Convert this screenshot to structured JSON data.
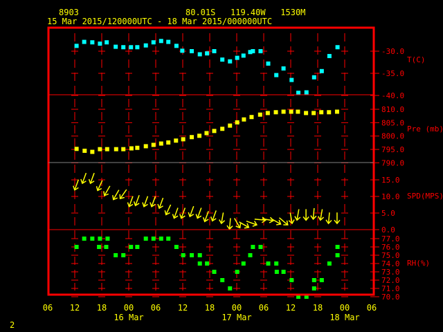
{
  "header": {
    "station": "8903",
    "location": "80.01S   119.40W   1530M",
    "period": "15 Mar 2015/120000UTC - 18 Mar 2015/000000UTC"
  },
  "page_number": "2",
  "x_axis": {
    "time_unit": "hours since 15 Mar 2015 12 UTC",
    "hour_labels": [
      "06",
      "12",
      "18",
      "00",
      "06",
      "12",
      "18",
      "00",
      "06",
      "12",
      "18",
      "00",
      "06"
    ],
    "hour_label_values": [
      -6,
      0,
      6,
      12,
      18,
      24,
      30,
      36,
      42,
      48,
      54,
      60,
      66
    ],
    "date_labels": [
      {
        "text": "16 Mar",
        "t": 12
      },
      {
        "text": "17 Mar",
        "t": 36
      },
      {
        "text": "18 Mar",
        "t": 60
      }
    ]
  },
  "colors": {
    "frame": "#ff0000",
    "temperature": "#00ffff",
    "pressure": "#ffff00",
    "wind": "#ffff00",
    "rh": "#00ff00",
    "text": "#ffff00",
    "grid_gray": "#808080"
  },
  "chart_data": [
    {
      "type": "scatter",
      "panel": "temperature",
      "ylabel": "T(C)",
      "ylim": [
        -40,
        -25
      ],
      "ticks": [
        "-30.0",
        "-35.0",
        "-40.0"
      ],
      "tick_values": [
        -30,
        -35,
        -40
      ],
      "x": [
        0.4,
        2.1,
        3.9,
        5.6,
        7.1,
        9.1,
        10.8,
        12.5,
        13.9,
        15.8,
        17.5,
        19.2,
        20.8,
        22.6,
        23.9,
        26.0,
        27.8,
        29.4,
        31.0,
        32.8,
        34.5,
        36.1,
        37.5,
        39.0,
        39.6,
        41.3,
        43.0,
        44.8,
        46.4,
        48.2,
        49.7,
        51.5,
        53.2,
        54.9,
        56.6,
        58.4
      ],
      "y": [
        -28.8,
        -27.9,
        -28.0,
        -28.3,
        -28.0,
        -29.0,
        -29.1,
        -29.1,
        -29.1,
        -28.7,
        -28.0,
        -27.7,
        -27.9,
        -28.8,
        -29.9,
        -30.0,
        -30.7,
        -30.5,
        -30.0,
        -31.9,
        -32.3,
        -31.5,
        -31.0,
        -30.2,
        -30.0,
        -30.0,
        -32.8,
        -35.4,
        -33.9,
        -36.5,
        -39.4,
        -39.3,
        -35.9,
        -34.5,
        -31.1,
        -29.1
      ]
    },
    {
      "type": "scatter",
      "panel": "pressure",
      "ylabel": "Pre (mb)",
      "ylim": [
        790,
        812
      ],
      "ticks": [
        "810.0",
        "805.0",
        "800.0",
        "795.0",
        "790.0"
      ],
      "tick_values": [
        810,
        805,
        800,
        795,
        790
      ],
      "x": [
        0.4,
        2.2,
        3.9,
        5.6,
        7.2,
        9.2,
        10.8,
        12.6,
        13.9,
        15.8,
        17.5,
        19.2,
        20.8,
        22.5,
        24.1,
        26.0,
        27.7,
        29.3,
        31.0,
        32.8,
        34.5,
        36.1,
        37.6,
        39.3,
        41.2,
        42.9,
        44.7,
        46.4,
        48.1,
        49.6,
        51.4,
        53.1,
        54.8,
        56.5,
        58.3
      ],
      "y": [
        795.2,
        794.5,
        794.1,
        795.1,
        795.1,
        795.1,
        795.1,
        795.4,
        795.6,
        796.2,
        796.7,
        797.2,
        797.6,
        798.3,
        798.8,
        799.6,
        800.1,
        801.1,
        801.9,
        802.7,
        803.9,
        805.1,
        806.2,
        807.1,
        808.0,
        808.6,
        808.9,
        809.1,
        809.1,
        809.1,
        808.6,
        808.6,
        808.9,
        808.9,
        809.1
      ]
    },
    {
      "type": "scatter",
      "panel": "wind",
      "ylabel": "SPD(MPS)",
      "ylim": [
        0,
        20
      ],
      "ticks": [
        "15.0",
        "10.0",
        "5.0",
        "0.0"
      ],
      "tick_values": [
        15,
        10,
        5,
        0
      ],
      "x": [
        0.4,
        2.1,
        3.9,
        5.6,
        7.2,
        9.2,
        10.8,
        12.5,
        13.9,
        15.8,
        17.5,
        19.2,
        20.8,
        22.5,
        24.1,
        26.0,
        27.7,
        29.3,
        31.0,
        32.8,
        34.5,
        36.1,
        37.6,
        39.3,
        41.2,
        42.9,
        44.7,
        46.4,
        48.1,
        49.6,
        51.4,
        53.1,
        54.8,
        56.5,
        58.3
      ],
      "y": [
        13.5,
        15.5,
        15.5,
        13.3,
        11.7,
        10.5,
        10.7,
        8.5,
        8.8,
        8.5,
        8.5,
        8.0,
        6.0,
        5.0,
        5.0,
        5.5,
        5.0,
        4.0,
        4.2,
        3.5,
        1.8,
        2.0,
        1.5,
        2.0,
        3.0,
        3.0,
        2.5,
        2.5,
        3.5,
        4.5,
        4.5,
        4.8,
        4.5,
        3.5,
        3.5
      ],
      "arrow_dir_deg": [
        200,
        200,
        200,
        205,
        210,
        210,
        215,
        200,
        200,
        200,
        200,
        200,
        205,
        200,
        200,
        200,
        200,
        200,
        200,
        190,
        185,
        150,
        120,
        110,
        95,
        100,
        120,
        130,
        170,
        190,
        180,
        185,
        190,
        185,
        180
      ]
    },
    {
      "type": "scatter",
      "panel": "rh",
      "ylabel": "RH(%)",
      "ylim": [
        70,
        77
      ],
      "ticks": [
        "77.0",
        "76.0",
        "75.0",
        "74.0",
        "73.0",
        "72.0",
        "71.0",
        "70.0"
      ],
      "tick_values": [
        77,
        76,
        75,
        74,
        73,
        72,
        71,
        70
      ],
      "x": [
        0.4,
        2.1,
        3.9,
        5.6,
        5.4,
        7.0,
        7.3,
        9.1,
        10.8,
        12.5,
        13.9,
        15.8,
        17.5,
        19.2,
        20.8,
        22.6,
        24.1,
        26.0,
        27.8,
        27.8,
        29.4,
        31.0,
        32.8,
        34.5,
        36.1,
        37.5,
        39.0,
        39.6,
        41.3,
        43.0,
        44.8,
        44.9,
        46.4,
        48.2,
        49.7,
        51.5,
        53.2,
        53.2,
        54.9,
        56.6,
        58.4,
        58.4
      ],
      "y": [
        76,
        77,
        77,
        77,
        76,
        76,
        77,
        75,
        75,
        76,
        76,
        77,
        77,
        77,
        77,
        76,
        75,
        75,
        75,
        74,
        74,
        73,
        72,
        71,
        73,
        74,
        75,
        76,
        76,
        74,
        74,
        73,
        73,
        72,
        70,
        70,
        72,
        71,
        72,
        74,
        75,
        76
      ]
    }
  ]
}
